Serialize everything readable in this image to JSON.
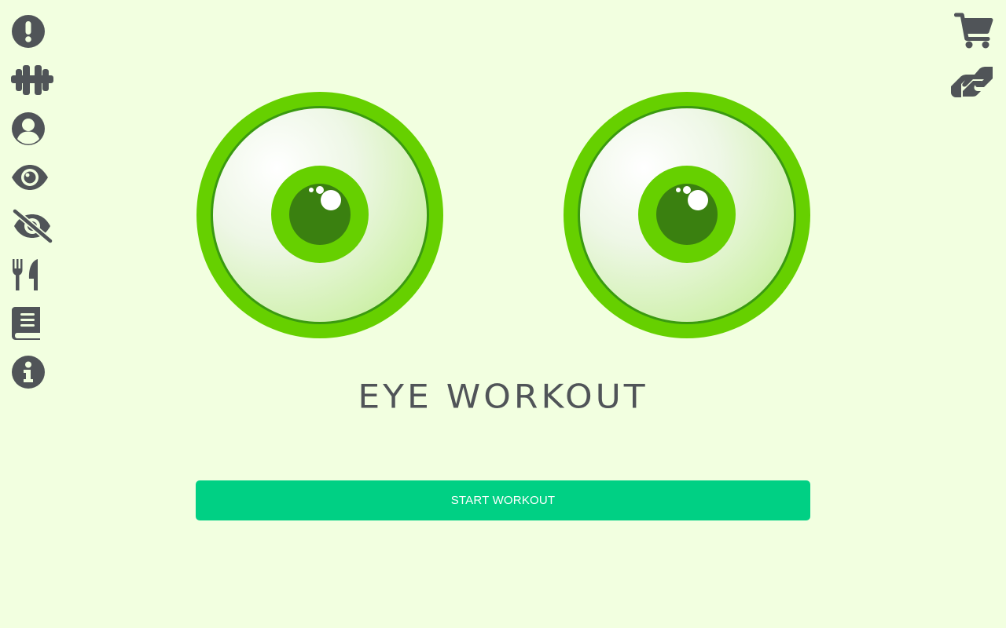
{
  "theme": {
    "background": "#f2ffe0",
    "icon_color": "#505458",
    "eye_ring": "#66d000",
    "iris_outer": "#66d000",
    "pupil": "#3a8010",
    "button_color": "#00d084"
  },
  "left_nav": [
    {
      "icon": "exclamation-circle-icon"
    },
    {
      "icon": "dumbbell-icon"
    },
    {
      "icon": "user-circle-icon"
    },
    {
      "icon": "eye-icon"
    },
    {
      "icon": "eye-slash-icon"
    },
    {
      "icon": "utensils-icon"
    },
    {
      "icon": "book-icon"
    },
    {
      "icon": "info-circle-icon"
    }
  ],
  "right_nav": [
    {
      "icon": "shopping-cart-icon"
    },
    {
      "icon": "handshake-icon"
    }
  ],
  "main": {
    "title": "EYE WORKOUT",
    "start_button_label": "START WORKOUT"
  }
}
